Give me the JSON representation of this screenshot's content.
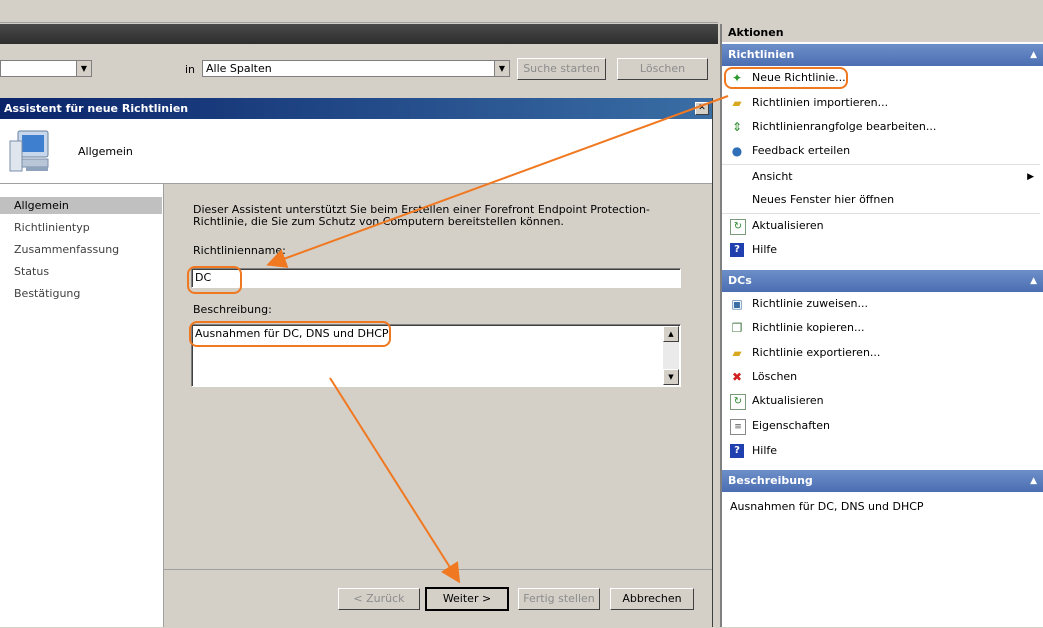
{
  "search": {
    "in_label": "in",
    "column_value": "Alle Spalten",
    "start_button": "Suche starten",
    "clear_button": "Löschen"
  },
  "wizard": {
    "title": "Assistent für neue Richtlinien",
    "header_label": "Allgemein",
    "steps": [
      "Allgemein",
      "Richtlinientyp",
      "Zusammenfassung",
      "Status",
      "Bestätigung"
    ],
    "intro": "Dieser Assistent unterstützt Sie beim Erstellen einer Forefront Endpoint Protection-Richtlinie, die Sie zum Schutz von Computern bereitstellen können.",
    "name_label": "Richtlinienname:",
    "name_value": "DC",
    "desc_label": "Beschreibung:",
    "desc_value": "Ausnahmen für DC, DNS und DHCP",
    "buttons": {
      "back": "< Zurück",
      "next": "Weiter >",
      "finish": "Fertig stellen",
      "cancel": "Abbrechen"
    }
  },
  "actions": {
    "title": "Aktionen",
    "sections": [
      {
        "title": "Richtlinien",
        "items": [
          "Neue Richtlinie...",
          "Richtlinien importieren...",
          "Richtlinienrangfolge bearbeiten...",
          "Feedback erteilen",
          "Ansicht",
          "Neues Fenster hier öffnen",
          "Aktualisieren",
          "Hilfe"
        ]
      },
      {
        "title": "DCs",
        "items": [
          "Richtlinie zuweisen...",
          "Richtlinie kopieren...",
          "Richtlinie exportieren...",
          "Löschen",
          "Aktualisieren",
          "Eigenschaften",
          "Hilfe"
        ]
      },
      {
        "title": "Beschreibung",
        "text": "Ausnahmen für DC, DNS und DHCP"
      }
    ]
  },
  "colors": {
    "highlight": "#f07820",
    "section_header": "#5a7dbe",
    "title_bar": "#0a246a"
  }
}
